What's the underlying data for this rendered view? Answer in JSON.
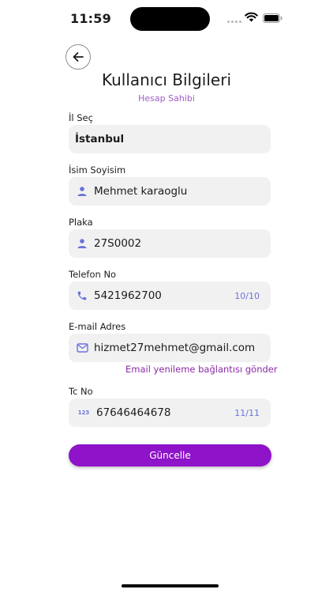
{
  "status_bar": {
    "time": "11:59"
  },
  "header": {
    "title": "Kullanıcı Bilgileri",
    "subtitle": "Hesap Sahibi"
  },
  "form": {
    "city": {
      "label": "İl Seç",
      "value": "İstanbul"
    },
    "name": {
      "label": "İsim Soyisim",
      "value": "Mehmet karaoglu",
      "icon": "person-icon"
    },
    "plate": {
      "label": "Plaka",
      "value": "27S0002",
      "icon": "person-icon"
    },
    "phone": {
      "label": "Telefon No",
      "value": "5421962700",
      "counter": "10/10",
      "icon": "phone-icon"
    },
    "email": {
      "label": "E-mail Adres",
      "value": "hizmet27mehmet@gmail.com",
      "icon": "mail-icon",
      "resend_link": "Email yenileme bağlantısı gönder"
    },
    "tc": {
      "label": "Tc No",
      "value": "67646464678",
      "counter": "11/11",
      "icon": "numbers-icon",
      "icon_text": "123"
    }
  },
  "actions": {
    "update_label": "Güncelle"
  },
  "colors": {
    "accent": "#8f13c9",
    "icon": "#6a72d9",
    "subtitle": "#a05cc8",
    "field_bg": "#f1f1f2"
  }
}
